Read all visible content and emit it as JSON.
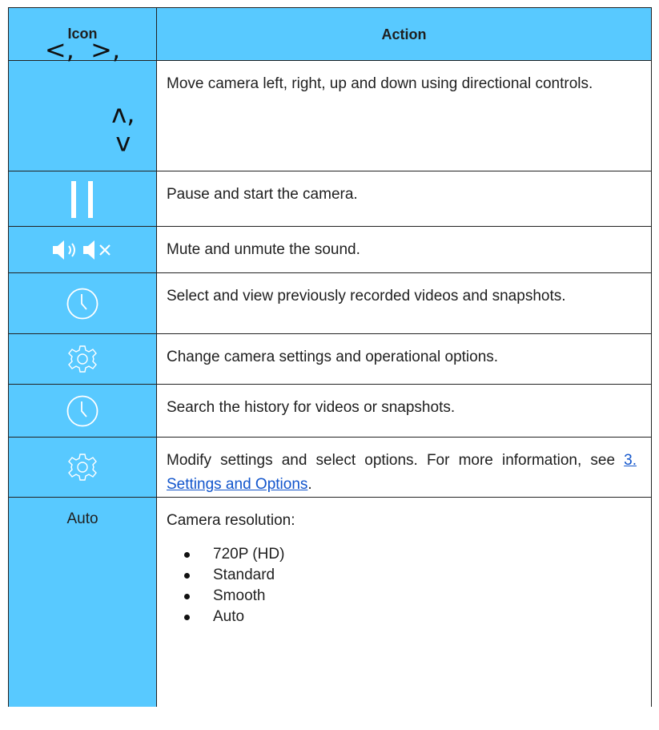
{
  "header": {
    "icon_col": "Icon",
    "action_col": "Action"
  },
  "rows": [
    {
      "icon": "directional-arrows-icon",
      "glyph_line1": "<,  >,",
      "glyph_line2": "ʌ, ʌ",
      "glyph_line2_a": "ʌ",
      "glyph_line2_b": "ʌ",
      "action": "Move camera left, right, up and down using directional controls."
    },
    {
      "icon": "pause-icon",
      "action": "Pause and start the camera."
    },
    {
      "icon": "speaker-mute-icon",
      "action": "Mute and unmute the sound."
    },
    {
      "icon": "clock-icon",
      "action": "Select and view previously recorded videos and snapshots."
    },
    {
      "icon": "gear-icon",
      "action": "Change camera settings and operational options."
    },
    {
      "icon": "clock-icon",
      "action": "Search the history for videos or snapshots."
    },
    {
      "icon": "gear-icon",
      "action_prefix": "Modify settings and select options. For more information, see ",
      "action_link": "3. Settings and Options",
      "action_suffix": "."
    },
    {
      "icon_text": "Auto",
      "action": "Camera resolution:",
      "options": [
        "720P (HD)",
        "Standard",
        "Smooth",
        "Auto"
      ]
    }
  ],
  "colors": {
    "icon_column_bg": "#58c9ff",
    "icon_white": "#ffffff",
    "link": "#1155cc"
  }
}
